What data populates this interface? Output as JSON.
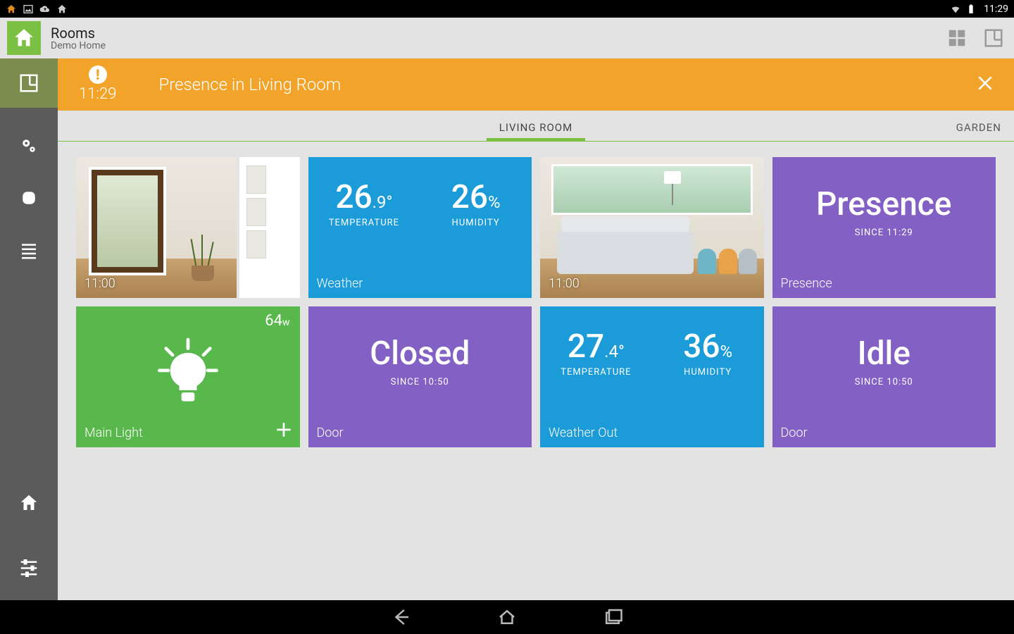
{
  "status_bar": {
    "clock": "11:29"
  },
  "action_bar": {
    "title": "Rooms",
    "subtitle": "Demo Home"
  },
  "alert": {
    "time": "11:29",
    "text": "Presence in Living Room"
  },
  "tabs": {
    "active": "LIVING ROOM",
    "other": "GARDEN"
  },
  "tiles": {
    "camera1": {
      "time": "11:00"
    },
    "weather": {
      "label": "Weather",
      "temp_whole": "26",
      "temp_frac": ".9°",
      "temp_caption": "TEMPERATURE",
      "hum_val": "26",
      "hum_unit": "%",
      "hum_caption": "HUMIDITY"
    },
    "camera2": {
      "time": "11:00"
    },
    "presence": {
      "label": "Presence",
      "title": "Presence",
      "since": "SINCE 11:29"
    },
    "light": {
      "label": "Main Light",
      "watts_val": "64",
      "watts_unit": "w"
    },
    "door": {
      "label": "Door",
      "title": "Closed",
      "since": "SINCE 10:50"
    },
    "weather_out": {
      "label": "Weather  Out",
      "temp_whole": "27",
      "temp_frac": ".4°",
      "temp_caption": "TEMPERATURE",
      "hum_val": "36",
      "hum_unit": "%",
      "hum_caption": "HUMIDITY"
    },
    "door2": {
      "label": "Door",
      "title": "Idle",
      "since": "SINCE 10:50"
    }
  }
}
